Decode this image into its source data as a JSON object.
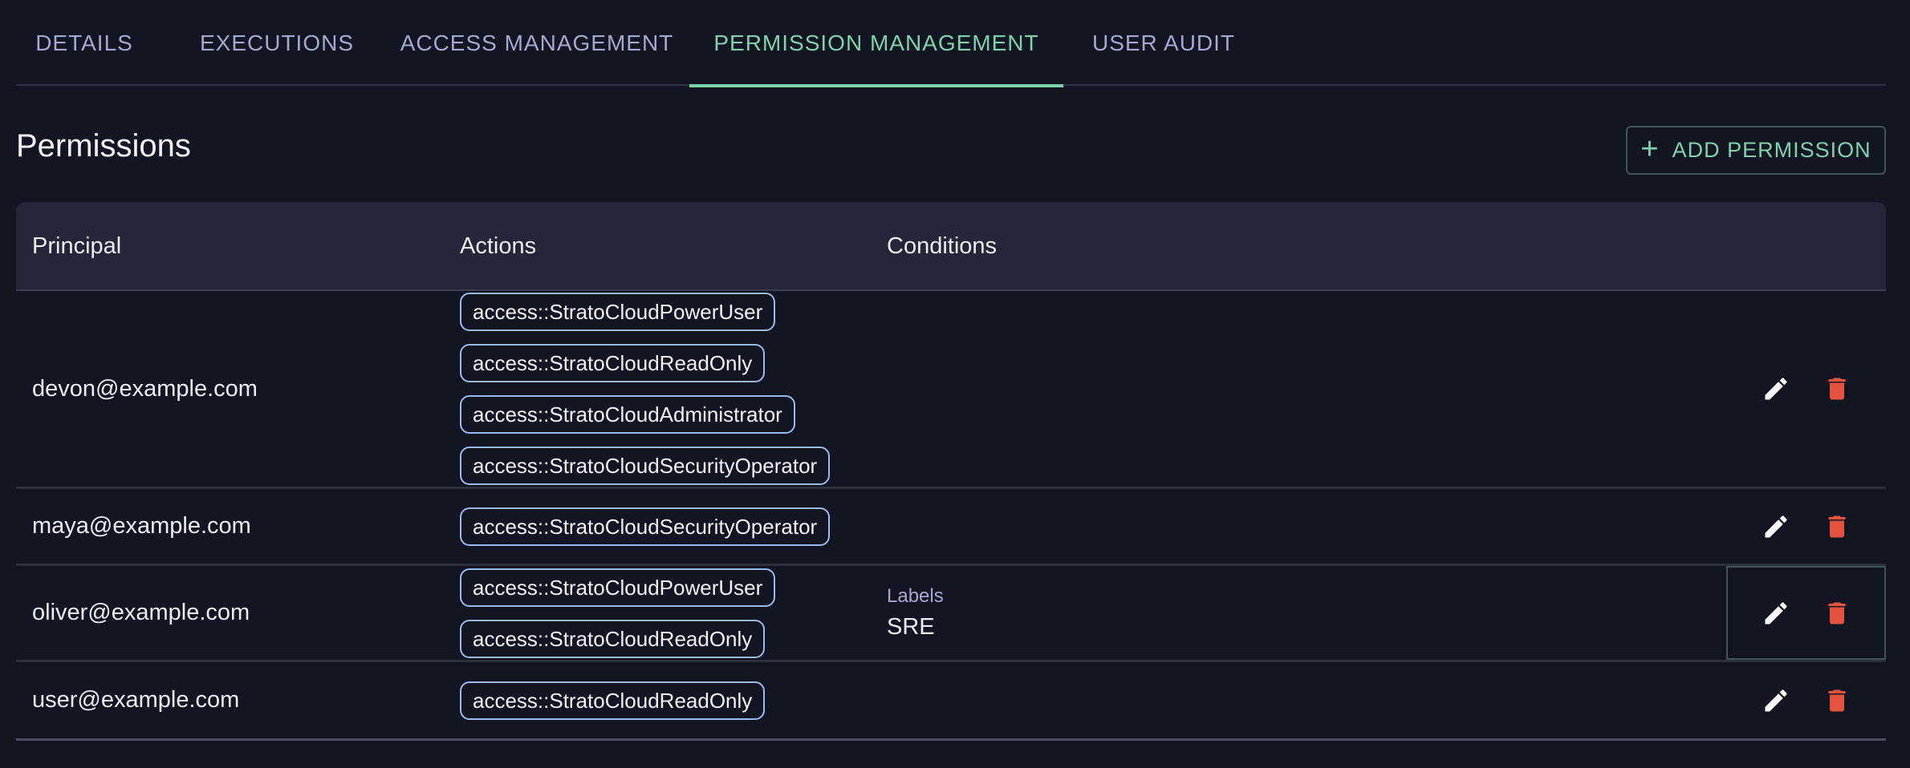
{
  "tabs": [
    {
      "label": "DETAILS"
    },
    {
      "label": "EXECUTIONS"
    },
    {
      "label": "ACCESS MANAGEMENT"
    },
    {
      "label": "PERMISSION MANAGEMENT",
      "active": true
    },
    {
      "label": "USER AUDIT"
    }
  ],
  "section": {
    "title": "Permissions",
    "add_button": "ADD PERMISSION"
  },
  "table": {
    "headers": {
      "principal": "Principal",
      "actions": "Actions",
      "conditions": "Conditions"
    },
    "rows": [
      {
        "principal": "devon@example.com",
        "actions": [
          "access::StratoCloudPowerUser",
          "access::StratoCloudReadOnly",
          "access::StratoCloudAdministrator",
          "access::StratoCloudSecurityOperator"
        ]
      },
      {
        "principal": "maya@example.com",
        "actions": [
          "access::StratoCloudSecurityOperator"
        ]
      },
      {
        "principal": "oliver@example.com",
        "actions": [
          "access::StratoCloudPowerUser",
          "access::StratoCloudReadOnly"
        ],
        "condition": {
          "label": "Labels",
          "value": "SRE"
        }
      },
      {
        "principal": "user@example.com",
        "actions": [
          "access::StratoCloudReadOnly"
        ]
      }
    ]
  },
  "colors": {
    "accent": "#7fd1aa",
    "delete": "#e5533f",
    "chip_border": "#9bb9f2"
  },
  "icons": {
    "edit": "pencil-icon",
    "delete": "trash-icon",
    "add": "plus-icon"
  }
}
